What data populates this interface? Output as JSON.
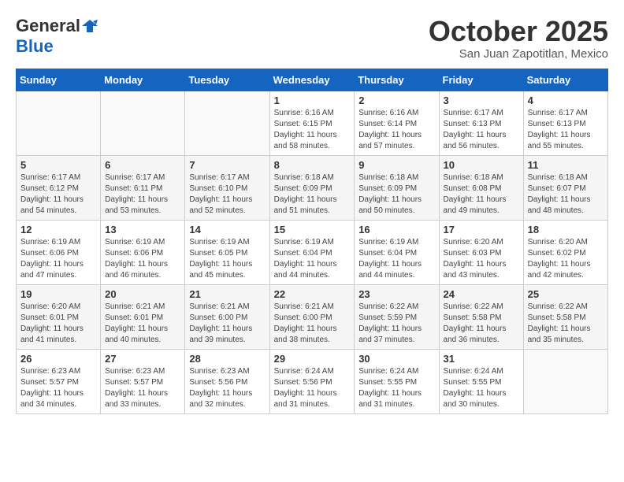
{
  "header": {
    "logo_general": "General",
    "logo_blue": "Blue",
    "month_title": "October 2025",
    "location": "San Juan Zapotitlan, Mexico"
  },
  "weekdays": [
    "Sunday",
    "Monday",
    "Tuesday",
    "Wednesday",
    "Thursday",
    "Friday",
    "Saturday"
  ],
  "weeks": [
    [
      {
        "num": "",
        "info": ""
      },
      {
        "num": "",
        "info": ""
      },
      {
        "num": "",
        "info": ""
      },
      {
        "num": "1",
        "info": "Sunrise: 6:16 AM\nSunset: 6:15 PM\nDaylight: 11 hours\nand 58 minutes."
      },
      {
        "num": "2",
        "info": "Sunrise: 6:16 AM\nSunset: 6:14 PM\nDaylight: 11 hours\nand 57 minutes."
      },
      {
        "num": "3",
        "info": "Sunrise: 6:17 AM\nSunset: 6:13 PM\nDaylight: 11 hours\nand 56 minutes."
      },
      {
        "num": "4",
        "info": "Sunrise: 6:17 AM\nSunset: 6:13 PM\nDaylight: 11 hours\nand 55 minutes."
      }
    ],
    [
      {
        "num": "5",
        "info": "Sunrise: 6:17 AM\nSunset: 6:12 PM\nDaylight: 11 hours\nand 54 minutes."
      },
      {
        "num": "6",
        "info": "Sunrise: 6:17 AM\nSunset: 6:11 PM\nDaylight: 11 hours\nand 53 minutes."
      },
      {
        "num": "7",
        "info": "Sunrise: 6:17 AM\nSunset: 6:10 PM\nDaylight: 11 hours\nand 52 minutes."
      },
      {
        "num": "8",
        "info": "Sunrise: 6:18 AM\nSunset: 6:09 PM\nDaylight: 11 hours\nand 51 minutes."
      },
      {
        "num": "9",
        "info": "Sunrise: 6:18 AM\nSunset: 6:09 PM\nDaylight: 11 hours\nand 50 minutes."
      },
      {
        "num": "10",
        "info": "Sunrise: 6:18 AM\nSunset: 6:08 PM\nDaylight: 11 hours\nand 49 minutes."
      },
      {
        "num": "11",
        "info": "Sunrise: 6:18 AM\nSunset: 6:07 PM\nDaylight: 11 hours\nand 48 minutes."
      }
    ],
    [
      {
        "num": "12",
        "info": "Sunrise: 6:19 AM\nSunset: 6:06 PM\nDaylight: 11 hours\nand 47 minutes."
      },
      {
        "num": "13",
        "info": "Sunrise: 6:19 AM\nSunset: 6:06 PM\nDaylight: 11 hours\nand 46 minutes."
      },
      {
        "num": "14",
        "info": "Sunrise: 6:19 AM\nSunset: 6:05 PM\nDaylight: 11 hours\nand 45 minutes."
      },
      {
        "num": "15",
        "info": "Sunrise: 6:19 AM\nSunset: 6:04 PM\nDaylight: 11 hours\nand 44 minutes."
      },
      {
        "num": "16",
        "info": "Sunrise: 6:19 AM\nSunset: 6:04 PM\nDaylight: 11 hours\nand 44 minutes."
      },
      {
        "num": "17",
        "info": "Sunrise: 6:20 AM\nSunset: 6:03 PM\nDaylight: 11 hours\nand 43 minutes."
      },
      {
        "num": "18",
        "info": "Sunrise: 6:20 AM\nSunset: 6:02 PM\nDaylight: 11 hours\nand 42 minutes."
      }
    ],
    [
      {
        "num": "19",
        "info": "Sunrise: 6:20 AM\nSunset: 6:01 PM\nDaylight: 11 hours\nand 41 minutes."
      },
      {
        "num": "20",
        "info": "Sunrise: 6:21 AM\nSunset: 6:01 PM\nDaylight: 11 hours\nand 40 minutes."
      },
      {
        "num": "21",
        "info": "Sunrise: 6:21 AM\nSunset: 6:00 PM\nDaylight: 11 hours\nand 39 minutes."
      },
      {
        "num": "22",
        "info": "Sunrise: 6:21 AM\nSunset: 6:00 PM\nDaylight: 11 hours\nand 38 minutes."
      },
      {
        "num": "23",
        "info": "Sunrise: 6:22 AM\nSunset: 5:59 PM\nDaylight: 11 hours\nand 37 minutes."
      },
      {
        "num": "24",
        "info": "Sunrise: 6:22 AM\nSunset: 5:58 PM\nDaylight: 11 hours\nand 36 minutes."
      },
      {
        "num": "25",
        "info": "Sunrise: 6:22 AM\nSunset: 5:58 PM\nDaylight: 11 hours\nand 35 minutes."
      }
    ],
    [
      {
        "num": "26",
        "info": "Sunrise: 6:23 AM\nSunset: 5:57 PM\nDaylight: 11 hours\nand 34 minutes."
      },
      {
        "num": "27",
        "info": "Sunrise: 6:23 AM\nSunset: 5:57 PM\nDaylight: 11 hours\nand 33 minutes."
      },
      {
        "num": "28",
        "info": "Sunrise: 6:23 AM\nSunset: 5:56 PM\nDaylight: 11 hours\nand 32 minutes."
      },
      {
        "num": "29",
        "info": "Sunrise: 6:24 AM\nSunset: 5:56 PM\nDaylight: 11 hours\nand 31 minutes."
      },
      {
        "num": "30",
        "info": "Sunrise: 6:24 AM\nSunset: 5:55 PM\nDaylight: 11 hours\nand 31 minutes."
      },
      {
        "num": "31",
        "info": "Sunrise: 6:24 AM\nSunset: 5:55 PM\nDaylight: 11 hours\nand 30 minutes."
      },
      {
        "num": "",
        "info": ""
      }
    ]
  ]
}
